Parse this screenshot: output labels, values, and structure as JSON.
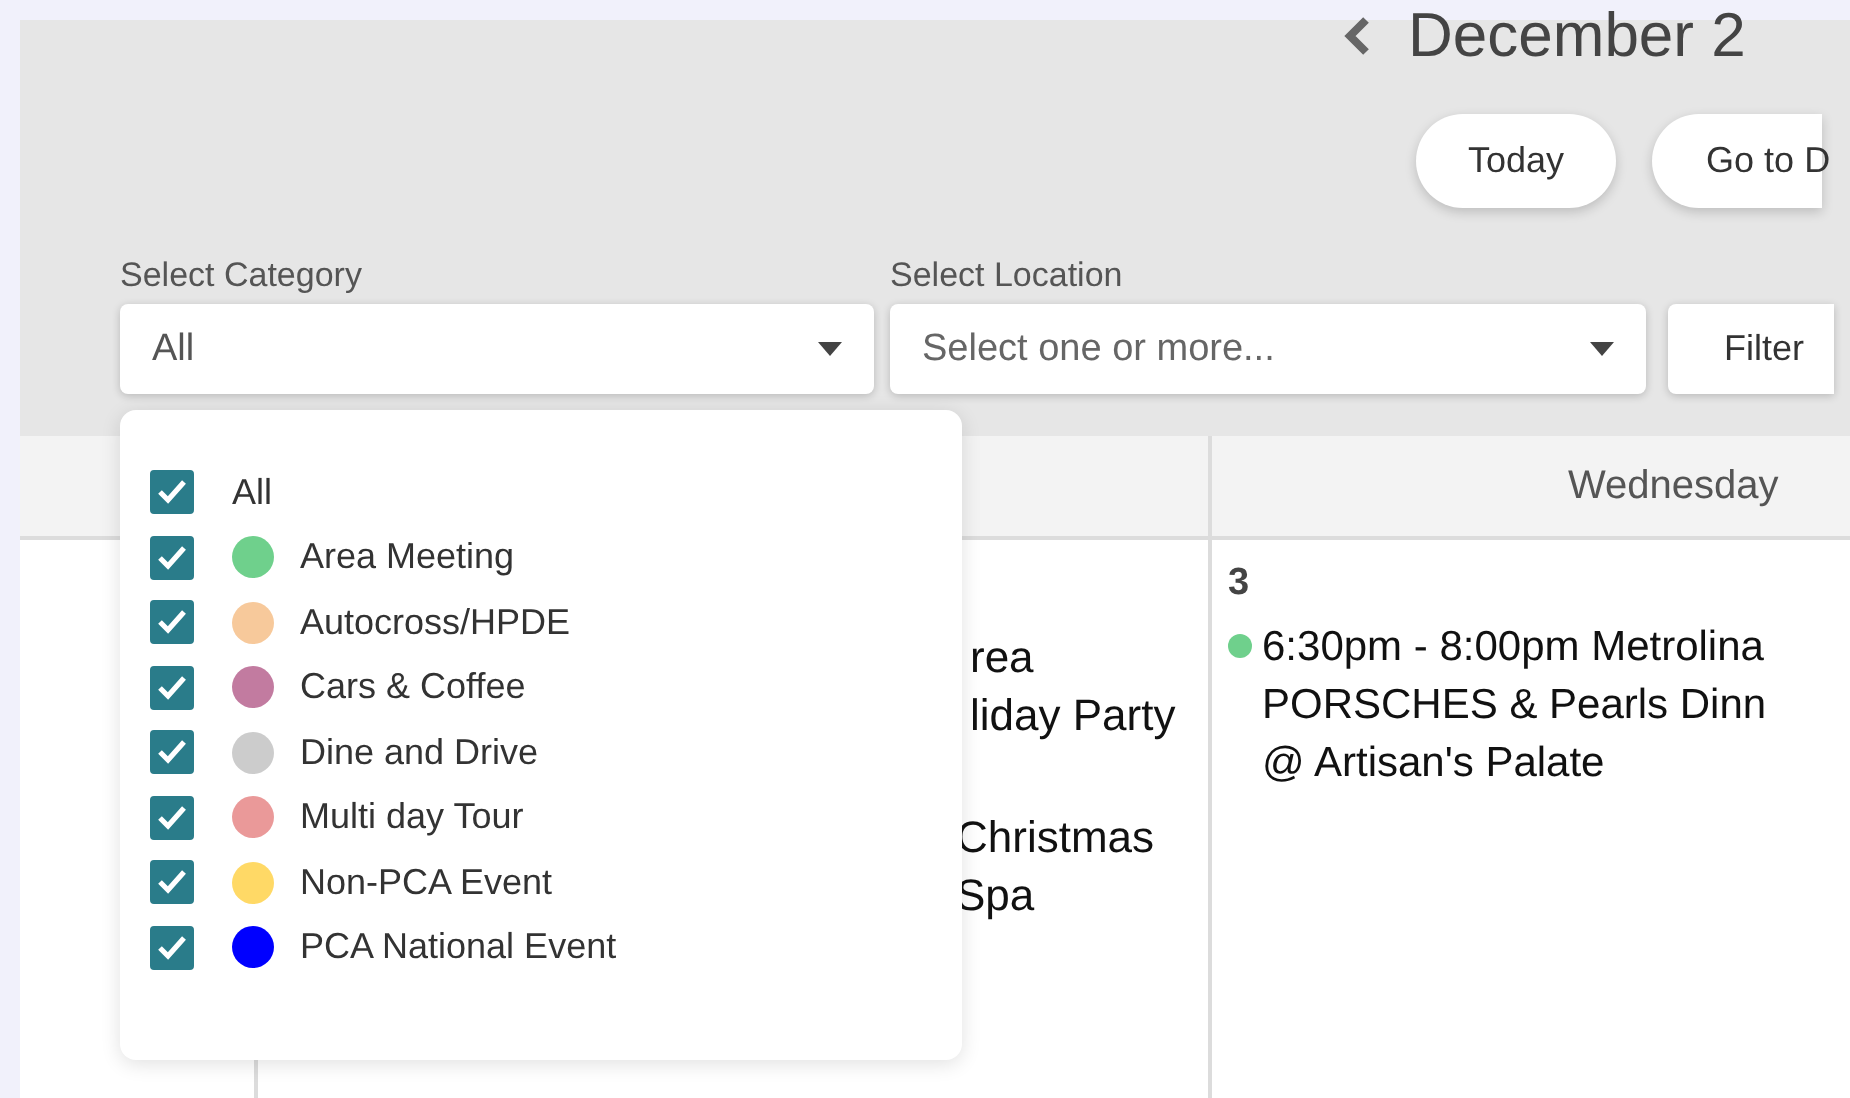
{
  "header": {
    "title": "December 2"
  },
  "buttons": [
    {
      "label": "Today"
    },
    {
      "label": "Go to D"
    }
  ],
  "filters": {
    "category": {
      "label": "Select Category",
      "value": "All"
    },
    "location": {
      "label": "Select Location",
      "placeholder": "Select one or more..."
    },
    "filter_button": "Filter"
  },
  "category_menu": [
    {
      "label": "All",
      "checked": true
    },
    {
      "label": "Area Meeting",
      "checked": true,
      "color": "#6fd08c"
    },
    {
      "label": "Autocross/HPDE",
      "checked": true,
      "color": "#f7c99b"
    },
    {
      "label": "Cars & Coffee",
      "checked": true,
      "color": "#c27ba0"
    },
    {
      "label": "Dine and Drive",
      "checked": true,
      "color": "#cccccc"
    },
    {
      "label": "Multi day Tour",
      "checked": true,
      "color": "#ea9999"
    },
    {
      "label": "Non-PCA Event",
      "checked": true,
      "color": "#ffd966"
    },
    {
      "label": "PCA National Event",
      "checked": true,
      "color": "#0000ff"
    }
  ],
  "calendar": {
    "column_2": {
      "event_fragments": [
        {
          "lines": [
            "rea",
            "liday Party"
          ]
        },
        {
          "lines": [
            "Christmas",
            "Spa"
          ]
        }
      ]
    },
    "column_3": {
      "heading": "Wednesday",
      "date": "3",
      "events": [
        {
          "color": "#6fd08c",
          "lines": [
            "6:30pm - 8:00pm Metrolina",
            "PORSCHES & Pearls Dinn",
            "@ Artisan's Palate"
          ]
        }
      ]
    }
  }
}
